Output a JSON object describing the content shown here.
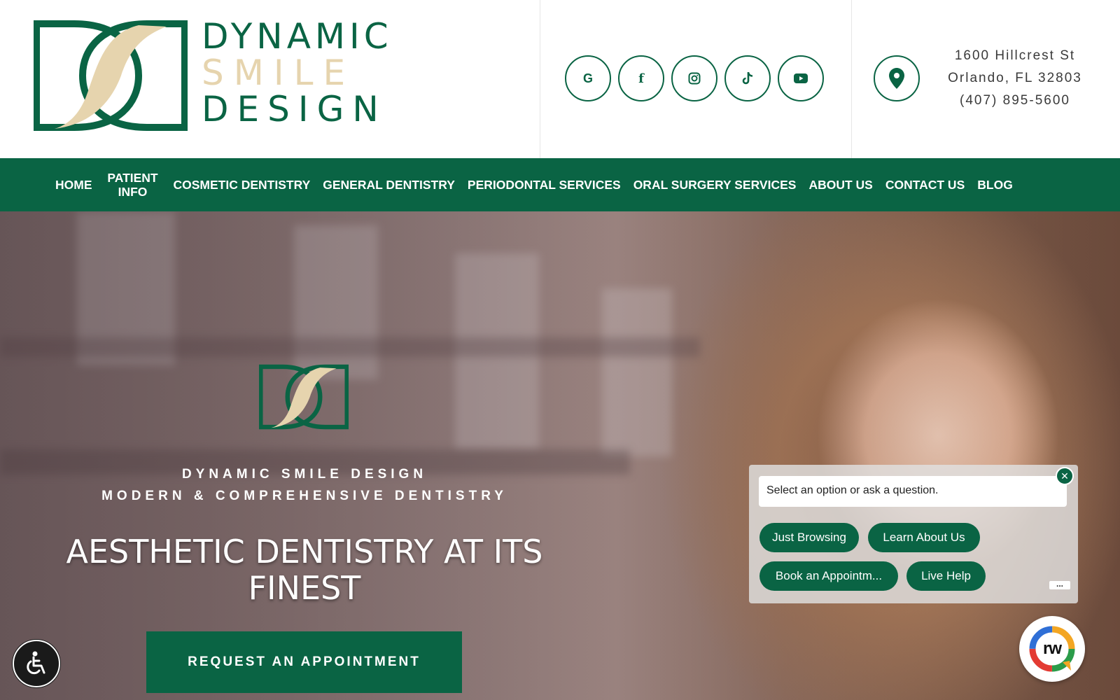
{
  "brand": {
    "line1": "DYNAMIC",
    "line2": "SMILE",
    "line3": "DESIGN",
    "green": "#0a6444",
    "gold": "#e6d4ae"
  },
  "socials": [
    {
      "icon": "google-icon",
      "glyph": "G"
    },
    {
      "icon": "facebook-icon",
      "glyph": "f"
    },
    {
      "icon": "instagram-icon",
      "glyph": ""
    },
    {
      "icon": "tiktok-icon",
      "glyph": ""
    },
    {
      "icon": "youtube-icon",
      "glyph": ""
    }
  ],
  "contact": {
    "street": "1600 Hillcrest St",
    "city": "Orlando, FL 32803",
    "phone": "(407) 895-5600"
  },
  "nav": {
    "items": [
      "HOME",
      "PATIENT INFO",
      "COSMETIC DENTISTRY",
      "GENERAL DENTISTRY",
      "PERIODONTAL SERVICES",
      "ORAL SURGERY SERVICES",
      "ABOUT US",
      "CONTACT US",
      "BLOG"
    ]
  },
  "hero": {
    "sub1": "DYNAMIC SMILE DESIGN",
    "sub2": "MODERN & COMPREHENSIVE DENTISTRY",
    "title": "AESTHETIC DENTISTRY AT ITS FINEST",
    "cta": "REQUEST AN APPOINTMENT"
  },
  "chat": {
    "placeholder": "Select an option or ask a question.",
    "close": "✕",
    "options": [
      "Just Browsing",
      "Learn About Us",
      "Book an Appointm...",
      "Live Help"
    ],
    "more": "..."
  },
  "badge": {
    "text": "rw"
  }
}
